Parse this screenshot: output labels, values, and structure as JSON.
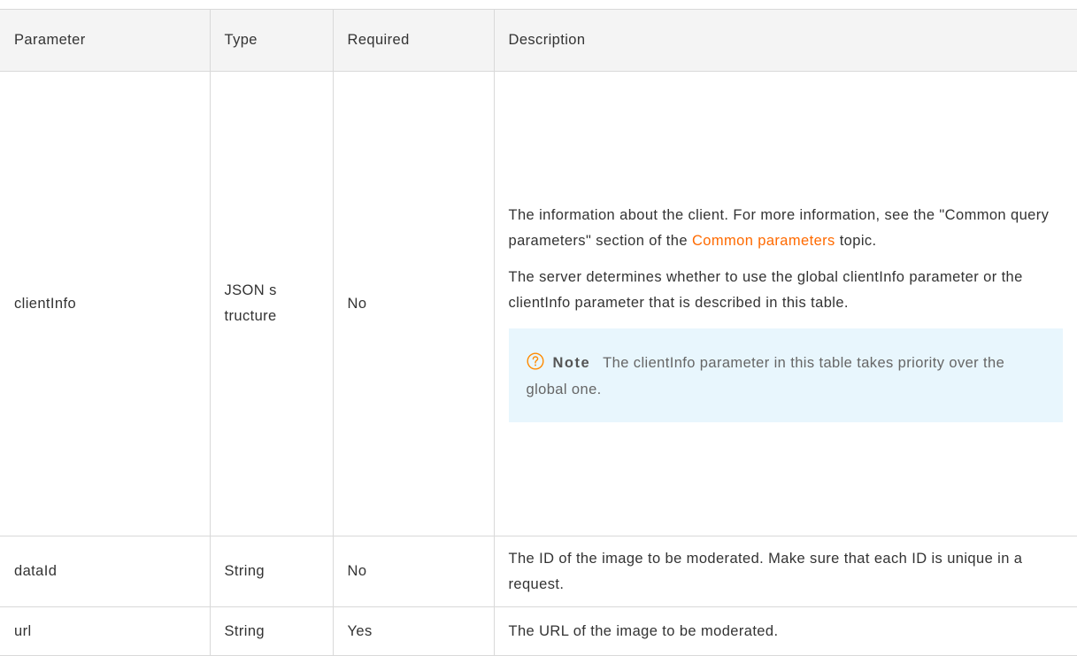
{
  "table": {
    "headers": {
      "parameter": "Parameter",
      "type": "Type",
      "required": "Required",
      "description": "Description"
    },
    "rows": [
      {
        "parameter": "clientInfo",
        "type": "JSON structure",
        "required": "No",
        "description": {
          "para1_before_link": "The information about the client. For more information, see the \"Common query parameters\" section of the ",
          "para1_link": "Common parameters",
          "para1_after_link": " topic.",
          "para2": "The server determines whether to use the global clientInfo parameter or the clientInfo parameter that is described in this table.",
          "note_label": "Note",
          "note_text": "The clientInfo parameter in this table takes priority over the global one.",
          "note_icon": "question-circle-icon"
        }
      },
      {
        "parameter": "dataId",
        "type": "String",
        "required": "No",
        "description": "The ID of the image to be moderated. Make sure that each ID is unique in a request."
      },
      {
        "parameter": "url",
        "type": "String",
        "required": "Yes",
        "description": "The URL of the image to be moderated."
      }
    ]
  },
  "colors": {
    "link": "#ff6a00",
    "note_background": "#e8f6fd",
    "note_icon": "#ff8a00",
    "header_background": "#f4f4f4"
  }
}
